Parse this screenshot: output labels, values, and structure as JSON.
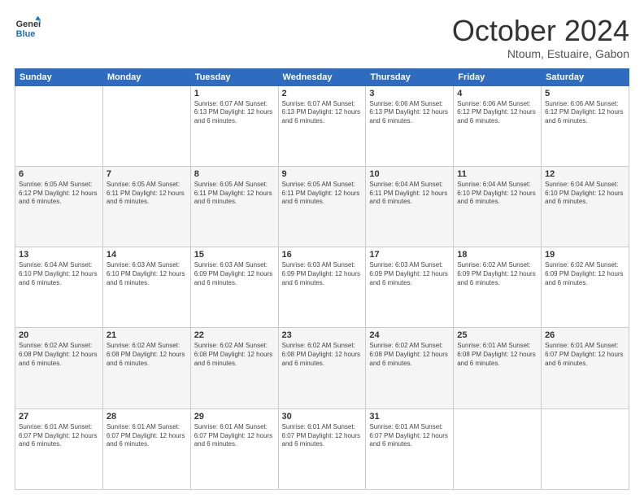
{
  "header": {
    "logo_line1": "General",
    "logo_line2": "Blue",
    "month": "October 2024",
    "location": "Ntoum, Estuaire, Gabon"
  },
  "weekdays": [
    "Sunday",
    "Monday",
    "Tuesday",
    "Wednesday",
    "Thursday",
    "Friday",
    "Saturday"
  ],
  "weeks": [
    [
      {
        "day": "",
        "content": ""
      },
      {
        "day": "",
        "content": ""
      },
      {
        "day": "1",
        "content": "Sunrise: 6:07 AM\nSunset: 6:13 PM\nDaylight: 12 hours\nand 6 minutes."
      },
      {
        "day": "2",
        "content": "Sunrise: 6:07 AM\nSunset: 6:13 PM\nDaylight: 12 hours\nand 6 minutes."
      },
      {
        "day": "3",
        "content": "Sunrise: 6:06 AM\nSunset: 6:13 PM\nDaylight: 12 hours\nand 6 minutes."
      },
      {
        "day": "4",
        "content": "Sunrise: 6:06 AM\nSunset: 6:12 PM\nDaylight: 12 hours\nand 6 minutes."
      },
      {
        "day": "5",
        "content": "Sunrise: 6:06 AM\nSunset: 6:12 PM\nDaylight: 12 hours\nand 6 minutes."
      }
    ],
    [
      {
        "day": "6",
        "content": "Sunrise: 6:05 AM\nSunset: 6:12 PM\nDaylight: 12 hours\nand 6 minutes."
      },
      {
        "day": "7",
        "content": "Sunrise: 6:05 AM\nSunset: 6:11 PM\nDaylight: 12 hours\nand 6 minutes."
      },
      {
        "day": "8",
        "content": "Sunrise: 6:05 AM\nSunset: 6:11 PM\nDaylight: 12 hours\nand 6 minutes."
      },
      {
        "day": "9",
        "content": "Sunrise: 6:05 AM\nSunset: 6:11 PM\nDaylight: 12 hours\nand 6 minutes."
      },
      {
        "day": "10",
        "content": "Sunrise: 6:04 AM\nSunset: 6:11 PM\nDaylight: 12 hours\nand 6 minutes."
      },
      {
        "day": "11",
        "content": "Sunrise: 6:04 AM\nSunset: 6:10 PM\nDaylight: 12 hours\nand 6 minutes."
      },
      {
        "day": "12",
        "content": "Sunrise: 6:04 AM\nSunset: 6:10 PM\nDaylight: 12 hours\nand 6 minutes."
      }
    ],
    [
      {
        "day": "13",
        "content": "Sunrise: 6:04 AM\nSunset: 6:10 PM\nDaylight: 12 hours\nand 6 minutes."
      },
      {
        "day": "14",
        "content": "Sunrise: 6:03 AM\nSunset: 6:10 PM\nDaylight: 12 hours\nand 6 minutes."
      },
      {
        "day": "15",
        "content": "Sunrise: 6:03 AM\nSunset: 6:09 PM\nDaylight: 12 hours\nand 6 minutes."
      },
      {
        "day": "16",
        "content": "Sunrise: 6:03 AM\nSunset: 6:09 PM\nDaylight: 12 hours\nand 6 minutes."
      },
      {
        "day": "17",
        "content": "Sunrise: 6:03 AM\nSunset: 6:09 PM\nDaylight: 12 hours\nand 6 minutes."
      },
      {
        "day": "18",
        "content": "Sunrise: 6:02 AM\nSunset: 6:09 PM\nDaylight: 12 hours\nand 6 minutes."
      },
      {
        "day": "19",
        "content": "Sunrise: 6:02 AM\nSunset: 6:09 PM\nDaylight: 12 hours\nand 6 minutes."
      }
    ],
    [
      {
        "day": "20",
        "content": "Sunrise: 6:02 AM\nSunset: 6:08 PM\nDaylight: 12 hours\nand 6 minutes."
      },
      {
        "day": "21",
        "content": "Sunrise: 6:02 AM\nSunset: 6:08 PM\nDaylight: 12 hours\nand 6 minutes."
      },
      {
        "day": "22",
        "content": "Sunrise: 6:02 AM\nSunset: 6:08 PM\nDaylight: 12 hours\nand 6 minutes."
      },
      {
        "day": "23",
        "content": "Sunrise: 6:02 AM\nSunset: 6:08 PM\nDaylight: 12 hours\nand 6 minutes."
      },
      {
        "day": "24",
        "content": "Sunrise: 6:02 AM\nSunset: 6:08 PM\nDaylight: 12 hours\nand 6 minutes."
      },
      {
        "day": "25",
        "content": "Sunrise: 6:01 AM\nSunset: 6:08 PM\nDaylight: 12 hours\nand 6 minutes."
      },
      {
        "day": "26",
        "content": "Sunrise: 6:01 AM\nSunset: 6:07 PM\nDaylight: 12 hours\nand 6 minutes."
      }
    ],
    [
      {
        "day": "27",
        "content": "Sunrise: 6:01 AM\nSunset: 6:07 PM\nDaylight: 12 hours\nand 6 minutes."
      },
      {
        "day": "28",
        "content": "Sunrise: 6:01 AM\nSunset: 6:07 PM\nDaylight: 12 hours\nand 6 minutes."
      },
      {
        "day": "29",
        "content": "Sunrise: 6:01 AM\nSunset: 6:07 PM\nDaylight: 12 hours\nand 6 minutes."
      },
      {
        "day": "30",
        "content": "Sunrise: 6:01 AM\nSunset: 6:07 PM\nDaylight: 12 hours\nand 6 minutes."
      },
      {
        "day": "31",
        "content": "Sunrise: 6:01 AM\nSunset: 6:07 PM\nDaylight: 12 hours\nand 6 minutes."
      },
      {
        "day": "",
        "content": ""
      },
      {
        "day": "",
        "content": ""
      }
    ]
  ]
}
